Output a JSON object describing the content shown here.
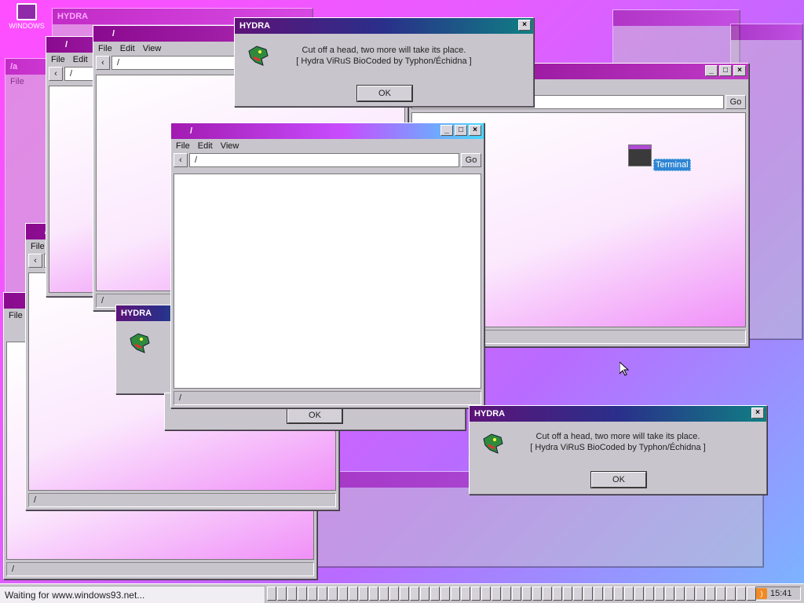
{
  "desktop": {
    "icon_label": "WINDOWS",
    "terminal_label": "Terminal"
  },
  "explorer": {
    "menu": {
      "file": "File",
      "edit": "Edit",
      "view": "View"
    },
    "back_label": "‹",
    "go_label": "Go",
    "path": "/",
    "status_path": "/",
    "title": "/",
    "partial_title": "/a"
  },
  "hydra": {
    "title": "HYDRA",
    "line1": "Cut off a head, two more will take its place.",
    "line2": "[ Hydra ViRuS BioCoded by Typhon/Échidna ]",
    "ok_label": "OK"
  },
  "taskbar": {
    "status_text": "Waiting for www.windows93.net...",
    "clock": "15:41",
    "rss_label": ")"
  },
  "colors": {
    "accent": "#b02fbf",
    "desktop_from": "#ff4dff",
    "desktop_to": "#7ab6ff"
  }
}
